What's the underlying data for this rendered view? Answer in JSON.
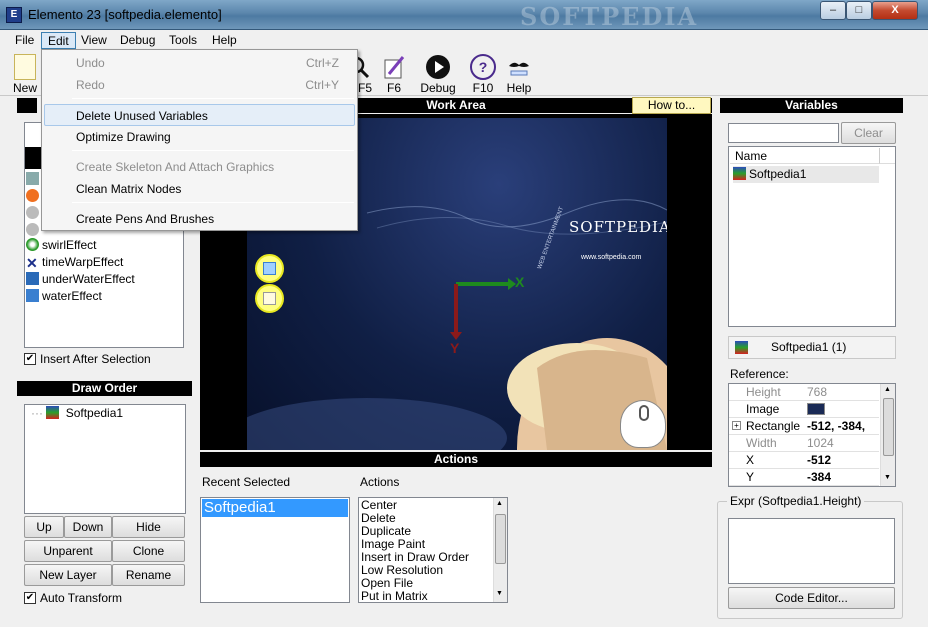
{
  "window": {
    "title": "Elemento 23 [softpedia.elemento]",
    "watermark": "SOFTPEDIA",
    "buttons": {
      "minimize": "–",
      "maximize": "□",
      "close": "X"
    }
  },
  "menubar": {
    "items": [
      "File",
      "Edit",
      "View",
      "Debug",
      "Tools",
      "Help"
    ]
  },
  "toolbar": {
    "new_label": "New",
    "f5_label": "F5",
    "f6_label": "F6",
    "debug_label": "Debug",
    "f10_label": "F10",
    "f10_icon_text": "?",
    "help_label": "Help"
  },
  "edit_menu": {
    "undo": {
      "label": "Undo",
      "shortcut": "Ctrl+Z"
    },
    "redo": {
      "label": "Redo",
      "shortcut": "Ctrl+Y"
    },
    "delete_unused": "Delete Unused Variables",
    "optimize": "Optimize Drawing",
    "create_skeleton": "Create Skeleton And Attach Graphics",
    "clean_matrix": "Clean Matrix Nodes",
    "create_pens": "Create Pens And Brushes"
  },
  "effects_list": {
    "items": [
      "swirlEffect",
      "timeWarpEffect",
      "underWaterEffect",
      "waterEffect"
    ]
  },
  "insert_after_selection": {
    "label": "Insert After Selection",
    "checked": true
  },
  "draw_order": {
    "header": "Draw Order",
    "items": [
      "Softpedia1"
    ],
    "buttons": {
      "up": "Up",
      "down": "Down",
      "hide": "Hide",
      "unparent": "Unparent",
      "clone": "Clone",
      "new_layer": "New Layer",
      "rename": "Rename"
    }
  },
  "auto_transform": {
    "label": "Auto Transform",
    "checked": true
  },
  "work_area": {
    "header": "Work Area",
    "howto_label": "How to...",
    "canvas": {
      "brand": "SOFTPEDIA",
      "trademark": "™",
      "url": "www.softpedia.com",
      "side_text": "WEB ENTERTAINMENT",
      "axis_x": "X",
      "axis_y": "Y"
    }
  },
  "actions_panel": {
    "header": "Actions",
    "recent_label": "Recent Selected",
    "recent_items": [
      "Softpedia1"
    ],
    "actions_label": "Actions",
    "actions_items": [
      "Center",
      "Delete",
      "Duplicate",
      "Image Paint",
      "Insert in Draw Order",
      "Low Resolution",
      "Open File",
      "Put in Matrix"
    ]
  },
  "variables": {
    "header": "Variables",
    "search_value": "",
    "clear_label": "Clear",
    "column_name": "Name",
    "items": [
      "Softpedia1"
    ],
    "selected_label": "Softpedia1 (1)",
    "reference_label": "Reference:",
    "properties": [
      {
        "name": "Height",
        "value": "768",
        "disabled": true
      },
      {
        "name": "Image",
        "value": "",
        "disabled": false
      },
      {
        "name": "Rectangle",
        "value": "-512, -384,",
        "disabled": false,
        "expandable": true
      },
      {
        "name": "Width",
        "value": "1024",
        "disabled": true
      },
      {
        "name": "X",
        "value": "-512",
        "disabled": false
      },
      {
        "name": "Y",
        "value": "-384",
        "disabled": false
      }
    ],
    "expr_label": "Expr (Softpedia1.Height)",
    "code_editor_label": "Code Editor..."
  },
  "colors": {
    "canvas_bg": "#0f1d3d",
    "x_axis": "#1e8a1e",
    "y_axis": "#8b1a1a",
    "header_bg": "#000000",
    "selection": "#3399ff"
  }
}
